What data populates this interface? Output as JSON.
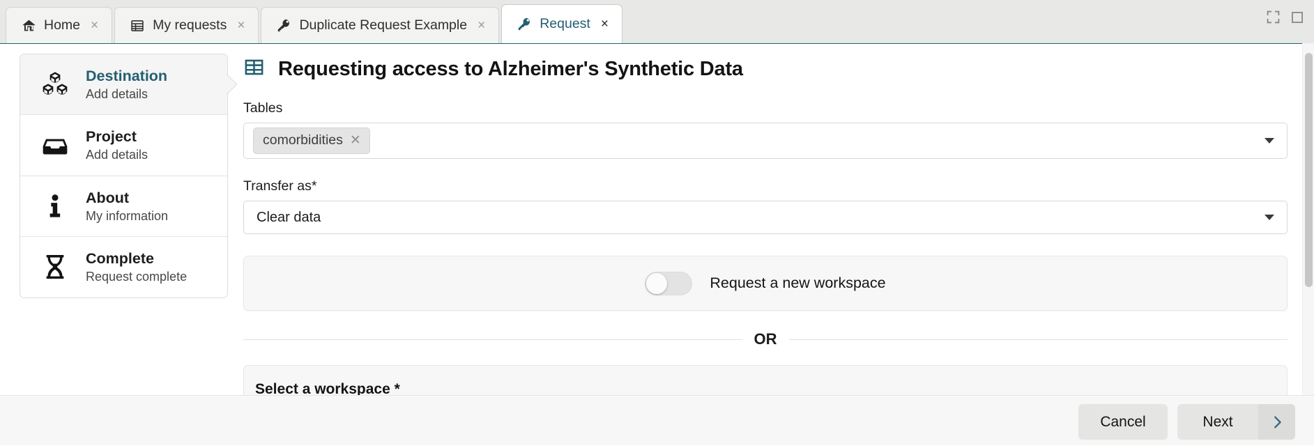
{
  "window": {
    "controls": [
      {
        "name": "fullscreen-button",
        "icon": "fullscreen-icon"
      },
      {
        "name": "restore-button",
        "icon": "restore-window-icon"
      }
    ]
  },
  "tabs": [
    {
      "label": "Home",
      "icon": "home-icon",
      "active": false,
      "close": "×"
    },
    {
      "label": "My requests",
      "icon": "table-list-icon",
      "active": false,
      "close": "×"
    },
    {
      "label": "Duplicate Request Example",
      "icon": "key-icon",
      "active": false,
      "close": "×"
    },
    {
      "label": "Request",
      "icon": "key-icon",
      "active": true,
      "close": "×"
    }
  ],
  "sidebar": {
    "items": [
      {
        "title": "Destination",
        "subtitle": "Add details",
        "icon": "cubes-icon",
        "active": true
      },
      {
        "title": "Project",
        "subtitle": "Add details",
        "icon": "inbox-icon",
        "active": false
      },
      {
        "title": "About",
        "subtitle": "My information",
        "icon": "info-icon",
        "active": false
      },
      {
        "title": "Complete",
        "subtitle": "Request complete",
        "icon": "hourglass-icon",
        "active": false
      }
    ]
  },
  "main": {
    "title": "Requesting access to Alzheimer's Synthetic Data",
    "title_icon": "table-grid-icon",
    "tables": {
      "label": "Tables",
      "chips": [
        {
          "label": "comorbidities",
          "remove": "✕"
        }
      ],
      "caret": "chevron-down-icon"
    },
    "transfer_as": {
      "label": "Transfer as",
      "required_mark": "*",
      "value": "Clear data",
      "caret": "chevron-down-icon"
    },
    "workspace_toggle": {
      "label": "Request a new workspace",
      "state": "off"
    },
    "divider_text": "OR",
    "select_workspace": {
      "label": "Select a workspace",
      "required_mark": "*"
    }
  },
  "footer": {
    "cancel_label": "Cancel",
    "next_label": "Next",
    "next_arrow_icon": "chevron-right-icon"
  },
  "colors": {
    "accent_teal": "#245f73",
    "tabbar_bg": "#e8e9e7",
    "panel_bg": "#f7f7f7",
    "button_bg": "#e5e5e3"
  }
}
